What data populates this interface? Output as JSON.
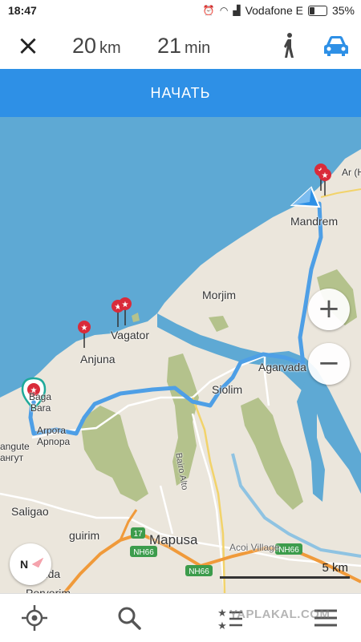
{
  "status_bar": {
    "time": "18:47",
    "carrier": "Vodafone E",
    "battery": "35%",
    "battery_level": 0.35
  },
  "route": {
    "distance_value": "20",
    "distance_unit": "km",
    "duration_value": "21",
    "duration_unit": "min",
    "modes": [
      "walk-icon",
      "car-icon"
    ],
    "active_mode": "car",
    "accent_color": "#2e90e6"
  },
  "start_button": {
    "label": "НАЧАТЬ"
  },
  "map": {
    "places": {
      "mandrem": "Mandrem",
      "arambol_partial": "Ar (Ha",
      "morjim": "Morjim",
      "vagator": "Vagator",
      "anjuna": "Anjuna",
      "agarvada": "Agarvada",
      "siolim": "Siolim",
      "baga_line1": "Baga",
      "baga_line2": "Bara",
      "arpora": "Arpora",
      "arpora_ru": "Арпора",
      "calangute": "angute",
      "calangute_ru": "ангут",
      "saligao": "Saligao",
      "guirim": "guirim",
      "mapusa": "Mapusa",
      "acoi_village": "Acoi Village",
      "sangolda": "Sangolda",
      "porvorim": "Porvorim",
      "bairo_alto": "Bairo Alto"
    },
    "road_shields": {
      "nh17": "17",
      "nh66_a": "NH66",
      "nh66_b": "NH66",
      "nh66_c": "NH66"
    },
    "scale_label": "5 km",
    "zoom_in": "+",
    "zoom_out": "−",
    "compass_letter": "N",
    "colors": {
      "sea": "#5ea9d4",
      "land": "#ebe6dc",
      "forest": "#b4c28c",
      "route": "#4e9fe6",
      "highway": "#f09a3a",
      "pin": "#d92b3a"
    }
  },
  "bottom_bar": {
    "buttons": [
      "location-icon",
      "search-icon",
      "favorites-icon",
      "menu-icon"
    ],
    "watermark": "YAPLAKAL.COM"
  }
}
